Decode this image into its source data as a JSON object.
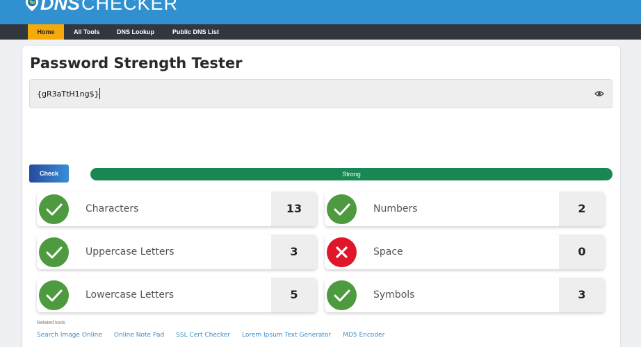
{
  "logo": {
    "part1": "DNS",
    "part2": "CHECKER"
  },
  "nav": [
    {
      "label": "Home",
      "active": true
    },
    {
      "label": "All Tools"
    },
    {
      "label": "DNS Lookup"
    },
    {
      "label": "Public DNS List"
    }
  ],
  "title": "Password Strength Tester",
  "password": {
    "value": "{gR3aTtH1ng$}",
    "toggle_icon": "eye-icon"
  },
  "check_button": "Check",
  "strength": {
    "label": "Strong",
    "color": "#198754"
  },
  "criteria": [
    {
      "label": "Characters",
      "count": "13",
      "status": "pass"
    },
    {
      "label": "Numbers",
      "count": "2",
      "status": "pass"
    },
    {
      "label": "Uppercase Letters",
      "count": "3",
      "status": "pass"
    },
    {
      "label": "Space",
      "count": "0",
      "status": "fail"
    },
    {
      "label": "Lowercase Letters",
      "count": "5",
      "status": "pass"
    },
    {
      "label": "Symbols",
      "count": "3",
      "status": "pass"
    }
  ],
  "related": {
    "title": "Related tools",
    "links": [
      "Search Image Online",
      "Online Note Pad",
      "SSL Cert Checker",
      "Lorem Ipsum Text Generator",
      "MD5 Encoder"
    ]
  },
  "colors": {
    "header": "#3191d0",
    "navbar": "#32373e",
    "nav_active": "#f5a90a",
    "pass": "#4e9a3f",
    "fail": "#e0162b",
    "link": "#3b8fc7"
  }
}
